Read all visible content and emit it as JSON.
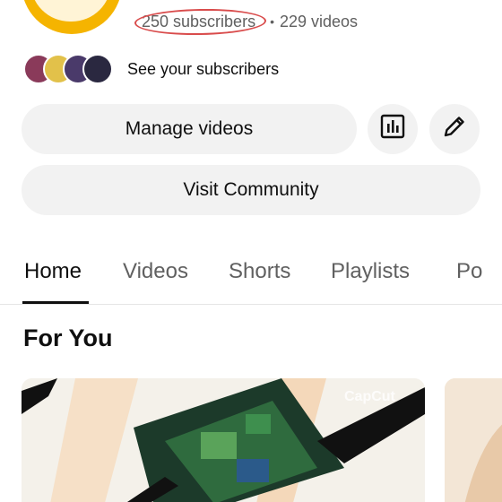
{
  "channel": {
    "stats": {
      "subscribers": "250 subscribers",
      "separator": "•",
      "videos": "229 videos"
    },
    "see_subscribers": "See your subscribers"
  },
  "actions": {
    "manage_videos": "Manage videos",
    "visit_community": "Visit Community",
    "stats_icon": "bar-chart-icon",
    "edit_icon": "pencil-icon"
  },
  "tabs": [
    {
      "label": "Home",
      "active": true
    },
    {
      "label": "Videos",
      "active": false
    },
    {
      "label": "Shorts",
      "active": false
    },
    {
      "label": "Playlists",
      "active": false
    },
    {
      "label": "Po",
      "active": false
    }
  ],
  "section": {
    "title": "For You"
  },
  "thumbnail": {
    "watermark": "CapCut"
  },
  "colors": {
    "annotation_ring": "#d94c4c",
    "button_bg": "#f2f2f2",
    "avatar_ring": "#f5b400"
  }
}
